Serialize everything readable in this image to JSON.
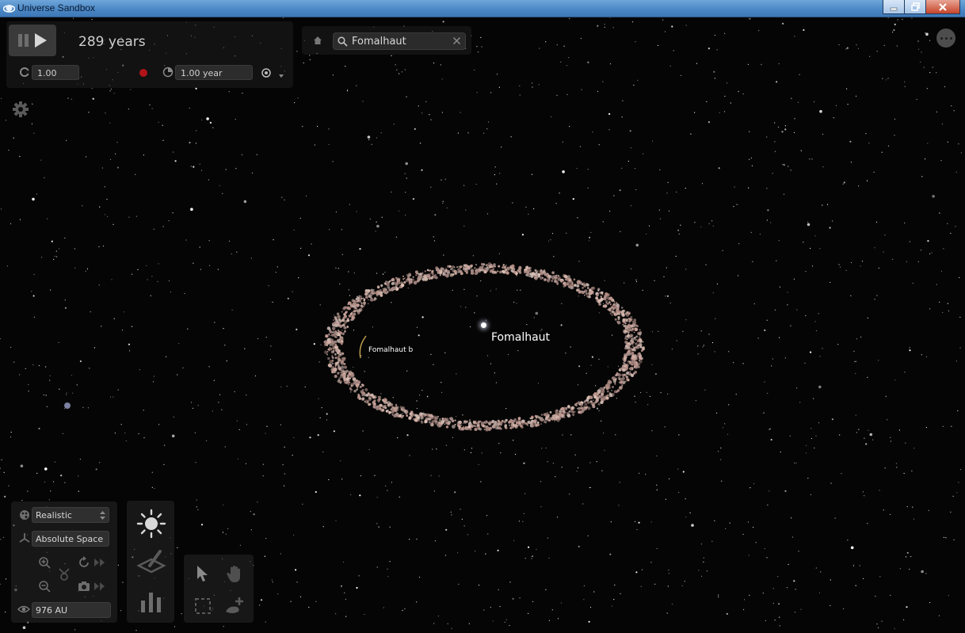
{
  "window": {
    "title": "Universe Sandbox"
  },
  "simulation": {
    "elapsed": "289 years",
    "time_scale": "1.00",
    "time_step": "1.00 year"
  },
  "search": {
    "value": "Fomalhaut"
  },
  "labels": {
    "star": "Fomalhaut",
    "planet": "Fomalhaut b"
  },
  "view": {
    "render_mode": "Realistic",
    "reference_frame": "Absolute Space",
    "view_distance": "976 AU"
  },
  "colors": {
    "titlebar": "#4a86c4",
    "panel": "#2c2c2c",
    "record": "#b0141a",
    "text": "#d8d8d8"
  },
  "icons": [
    "pause-icon",
    "play-icon",
    "gravity-icon",
    "record-icon",
    "clock-icon",
    "target-icon",
    "home-icon",
    "search-icon",
    "clear-icon",
    "more-icon",
    "settings-icon",
    "palette-icon",
    "axis-icon",
    "zoom-in-icon",
    "zoom-out-icon",
    "rotate-icon",
    "camera-icon",
    "eye-icon",
    "sun-icon",
    "grid-icon",
    "chart-icon",
    "pointer-icon",
    "hand-icon",
    "select-box-icon",
    "add-object-icon"
  ]
}
